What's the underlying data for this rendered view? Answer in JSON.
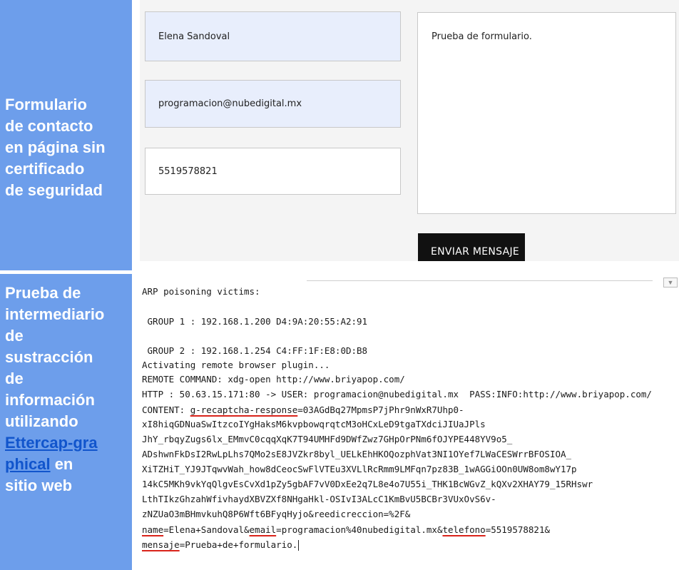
{
  "sidebar_top": {
    "lines": [
      "Formulario",
      "de contacto",
      "en página sin",
      "certificado",
      "de seguridad"
    ]
  },
  "sidebar_bottom": {
    "lines": [
      "Prueba de",
      "intermediario",
      "de",
      "sustracción",
      "de",
      "información",
      "utilizando"
    ],
    "link_part1": "Ettercap-gra",
    "link_part2": "phical",
    "after_link": " en",
    "last_line": "sitio web"
  },
  "form": {
    "name_value": "Elena Sandoval",
    "email_value": "programacion@nubedigital.mx",
    "phone_value": "5519578821",
    "message_value": "Prueba de formulario.",
    "send_label": "ENVIAR MENSAJE"
  },
  "terminal": {
    "victims_title": "ARP poisoning victims:",
    "group1": " GROUP 1 : 192.168.1.200 D4:9A:20:55:A2:91",
    "group2": " GROUP 2 : 192.168.1.254 C4:FF:1F:E8:0D:B8",
    "activating": "Activating remote browser plugin...",
    "remote_cmd": "REMOTE COMMAND: xdg-open http://www.briyapop.com/",
    "http_line": "HTTP : 50.63.15.171:80 -> USER: programacion@nubedigital.mx  PASS:INFO:http://www.briyapop.com/",
    "content_prefix": "CONTENT: ",
    "captcha_key": "g-recaptcha-response",
    "captcha_eq": "=03AGdBq27MpmsP7jPhr9nWxR7Uhp0-",
    "token_lines": [
      "xI8hiqGDNuaSwItzcoIYgHaksM6kvpbowqrqtcM3oHCxLeD9tgaTXdciJIUaJPls",
      "JhY_rbqyZugs6lx_EMmvC0cqqXqK7T94UMHFd9DWfZwz7GHpOrPNm6fOJYPE448YV9o5_",
      "ADshwnFkDsI2RwLpLhs7QMo2sE8JVZkr8byl_UELkEhHKOQozphVat3NI1OYef7LWaCESWrrBFOSIOA_",
      "XiTZHiT_YJ9JTqwvWah_how8dCeocSwFlVTEu3XVLlRcRmm9LMFqn7pz83B_1wAGGiOOn0UW8om8wY17p",
      "14kC5MKh9vkYqQlgvEsCvXd1pZy5gbAF7vV0DxEe2q7L8e4o7U55i_THK1BcWGvZ_kQXv2XHAY79_15RHswr",
      "LthTIkzGhzahWfivhaydXBVZXf8NHgaHkl-OSIvI3ALcC1KmBvU5BCBr3VUxOvS6v-",
      "zNZUaO3mBHmvkuhQ8P6Wft6BFyqHyjo&reedicreccion=%2F&"
    ],
    "name_key": "name",
    "name_val": "=Elena+Sandoval&",
    "email_key": "email",
    "email_val": "=programacion%40nubedigital.mx&",
    "tel_key": "telefono",
    "tel_val": "=5519578821&",
    "msg_key": "mensaje",
    "msg_val": "=Prueba+de+formulario."
  },
  "colors": {
    "sidebar": "#6d9eeb",
    "link": "#1155cc",
    "underline": "#d9231a",
    "field_fill": "#e8eefc",
    "button": "#111111"
  }
}
